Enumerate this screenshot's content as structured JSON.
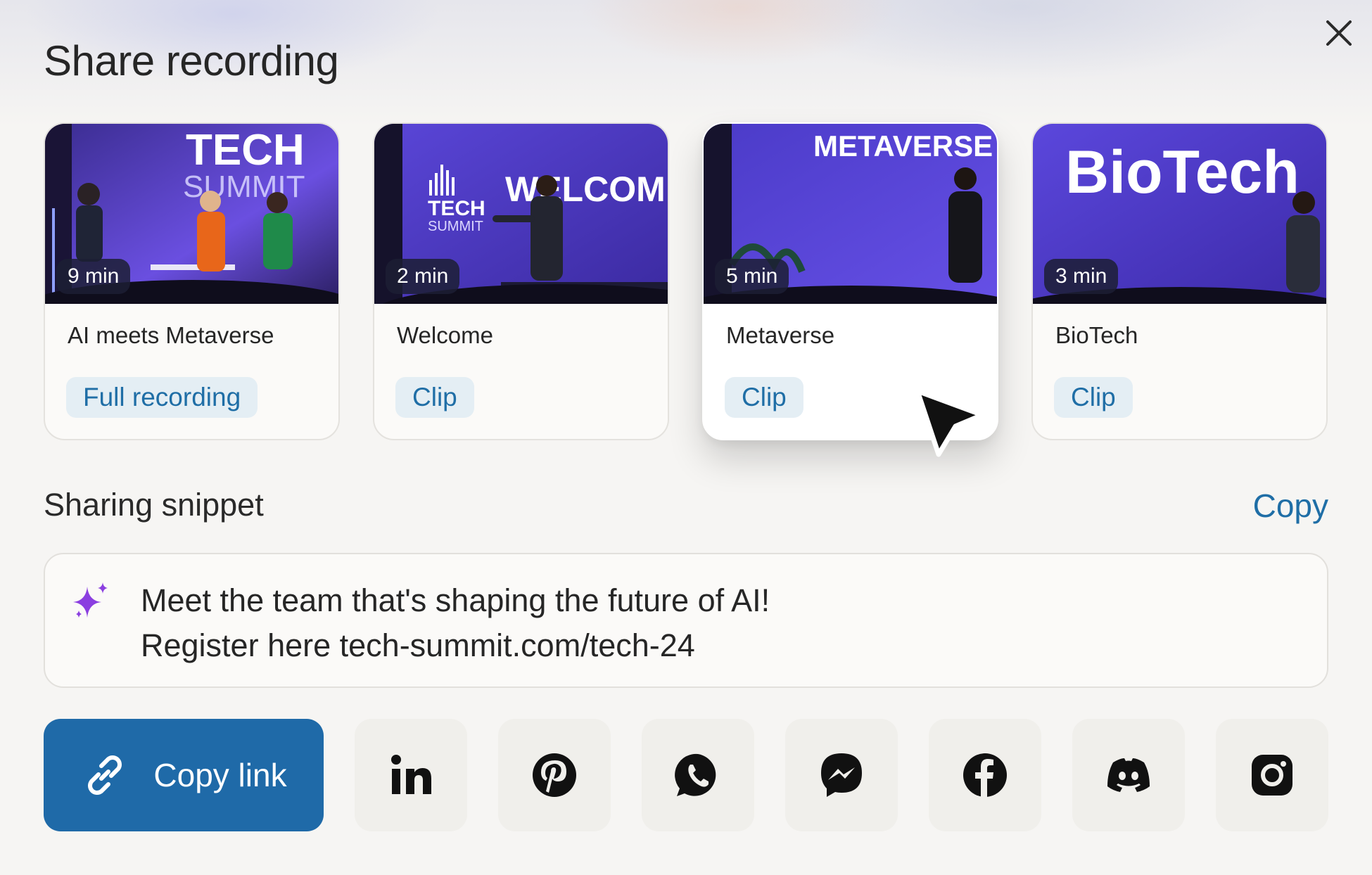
{
  "dialog": {
    "title": "Share recording",
    "close_icon": "close-icon"
  },
  "recordings": [
    {
      "title": "AI meets Metaverse",
      "duration": "9 min",
      "tag": "Full recording",
      "stage_text_1": "TECH",
      "stage_text_2": "SUMMIT",
      "selected": false
    },
    {
      "title": "Welcome",
      "duration": "2 min",
      "tag": "Clip",
      "stage_text_1": "TECH",
      "stage_text_2": "SUMMIT",
      "stage_text_3": "WELCOME",
      "selected": false
    },
    {
      "title": "Metaverse",
      "duration": "5 min",
      "tag": "Clip",
      "stage_text_1": "METAVERSE",
      "selected": true
    },
    {
      "title": "BioTech",
      "duration": "3 min",
      "tag": "Clip",
      "stage_text_1": "BioTech",
      "selected": false
    }
  ],
  "snippet": {
    "label": "Sharing snippet",
    "copy_label": "Copy",
    "line1": "Meet the team that's shaping the future of AI!",
    "line2": "Register here tech-summit.com/tech-24",
    "icon": "sparkle-icon"
  },
  "share": {
    "copy_link_label": "Copy link",
    "copy_link_icon": "link-icon",
    "socials": [
      "linkedin-icon",
      "pinterest-icon",
      "whatsapp-icon",
      "messenger-icon",
      "facebook-icon",
      "discord-icon",
      "instagram-icon"
    ]
  },
  "colors": {
    "accent": "#1f6aa8",
    "tag_bg": "#e4eef4",
    "tag_text": "#1f6ea6",
    "sparkle": "#8b3fe0",
    "stage_purple": "#5c45d8"
  }
}
